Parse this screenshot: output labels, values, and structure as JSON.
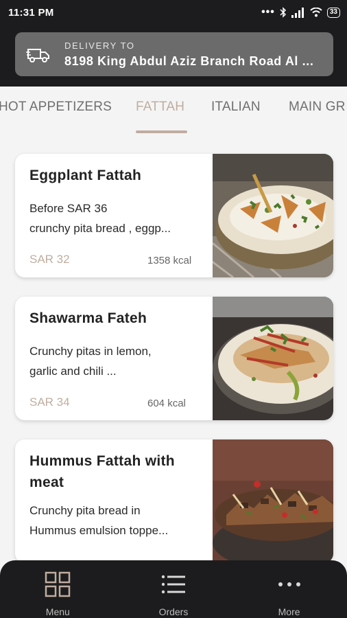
{
  "status_bar": {
    "time": "11:31 PM",
    "battery": "33"
  },
  "header": {
    "delivery_label": "DELIVERY TO",
    "delivery_address": "8198 King Abdul Aziz Branch Road Al ..."
  },
  "tabs": [
    {
      "label": "HOT APPETIZERS",
      "active": false
    },
    {
      "label": "FATTAH",
      "active": true
    },
    {
      "label": "ITALIAN",
      "active": false
    },
    {
      "label": "MAIN GR",
      "active": false
    }
  ],
  "items": [
    {
      "title": "Eggplant Fattah",
      "description_lines": [
        "Before SAR 36",
        "crunchy pita bread , eggp..."
      ],
      "price": "SAR 32",
      "kcal": "1358 kcal",
      "image": "eggplant-fattah-photo"
    },
    {
      "title": "Shawarma Fateh",
      "description_lines": [
        "Crunchy pitas in lemon,",
        "garlic and chili ..."
      ],
      "price": "SAR 34",
      "kcal": "604 kcal",
      "image": "shawarma-fateh-photo"
    },
    {
      "title_lines": [
        "Hummus Fattah with",
        "meat"
      ],
      "description_lines": [
        "Crunchy pita bread in",
        "Hummus emulsion toppe..."
      ],
      "image": "hummus-fattah-photo"
    }
  ],
  "bottom_nav": [
    {
      "label": "Menu",
      "icon": "grid-icon"
    },
    {
      "label": "Orders",
      "icon": "list-icon"
    },
    {
      "label": "More",
      "icon": "more-dots-icon"
    }
  ],
  "colors": {
    "accent": "#c0ada0",
    "dark": "#1c1c1e",
    "address_box": "#6b6b6b"
  }
}
